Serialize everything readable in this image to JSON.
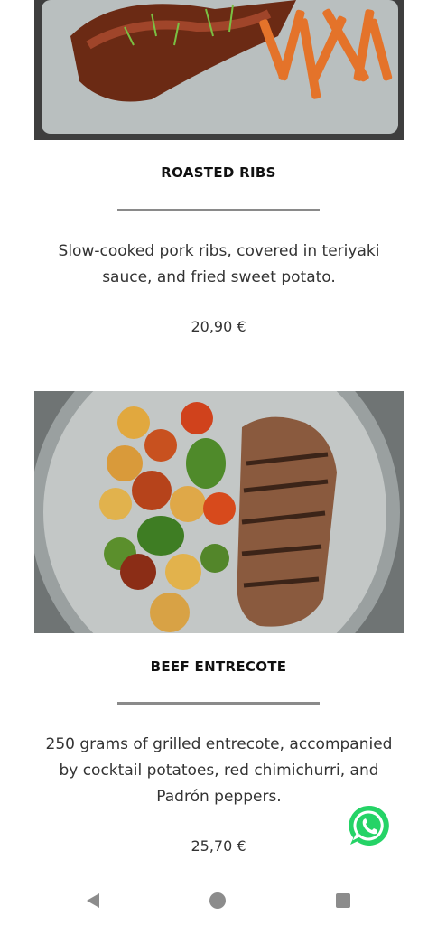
{
  "dishes": [
    {
      "name": "ROASTED RIBS",
      "description": "Slow-cooked pork ribs, covered in teriyaki sauce, and fried sweet potato.",
      "price": "20,90 €",
      "image": "ribs-with-sweet-potato-fries-photo"
    },
    {
      "name": "BEEF ENTRECOTE",
      "description": "250 grams of grilled entrecote, accompanied by cocktail potatoes, red chimichurri, and Padrón peppers.",
      "price": "25,70 €",
      "image": "grilled-entrecote-with-potatoes-photo"
    }
  ],
  "colors": {
    "divider": "#8a8a8a",
    "whatsapp": "#25d366",
    "nav_icon": "#8c8c8c"
  },
  "icons": {
    "whatsapp": "whatsapp-icon",
    "nav_back": "back-triangle-icon",
    "nav_home": "home-circle-icon",
    "nav_recents": "recents-square-icon"
  }
}
